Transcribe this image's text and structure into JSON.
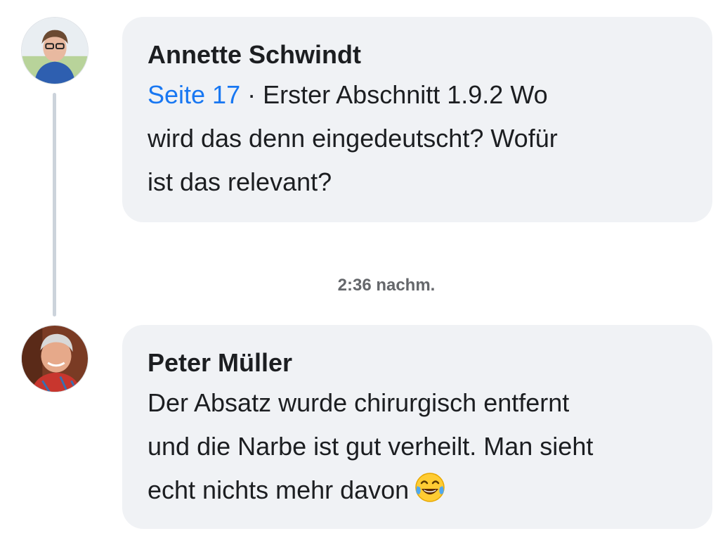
{
  "messages": [
    {
      "author": "Annette Schwindt",
      "avatar": "avatar-icon",
      "page_ref": "Seite 17",
      "separator": "·",
      "lines": [
        "Erster Abschnitt 1.9.2 Wo",
        "wird das denn eingedeutscht? Wofür",
        "ist das relevant?"
      ]
    },
    {
      "author": "Peter Müller",
      "avatar": "avatar-icon",
      "lines": [
        "Der Absatz wurde chirurgisch entfernt",
        "und die Narbe ist gut verheilt. Man sieht",
        "echt nichts mehr davon"
      ],
      "emoji": "face-with-tears-of-joy-icon"
    }
  ],
  "timestamp": "2:36 nachm.",
  "colors": {
    "bubble_background": "#f0f2f5",
    "link_blue": "#1877f2",
    "text": "#1c1e21",
    "timestamp": "#65676b",
    "thread_line": "#ccd3db"
  }
}
